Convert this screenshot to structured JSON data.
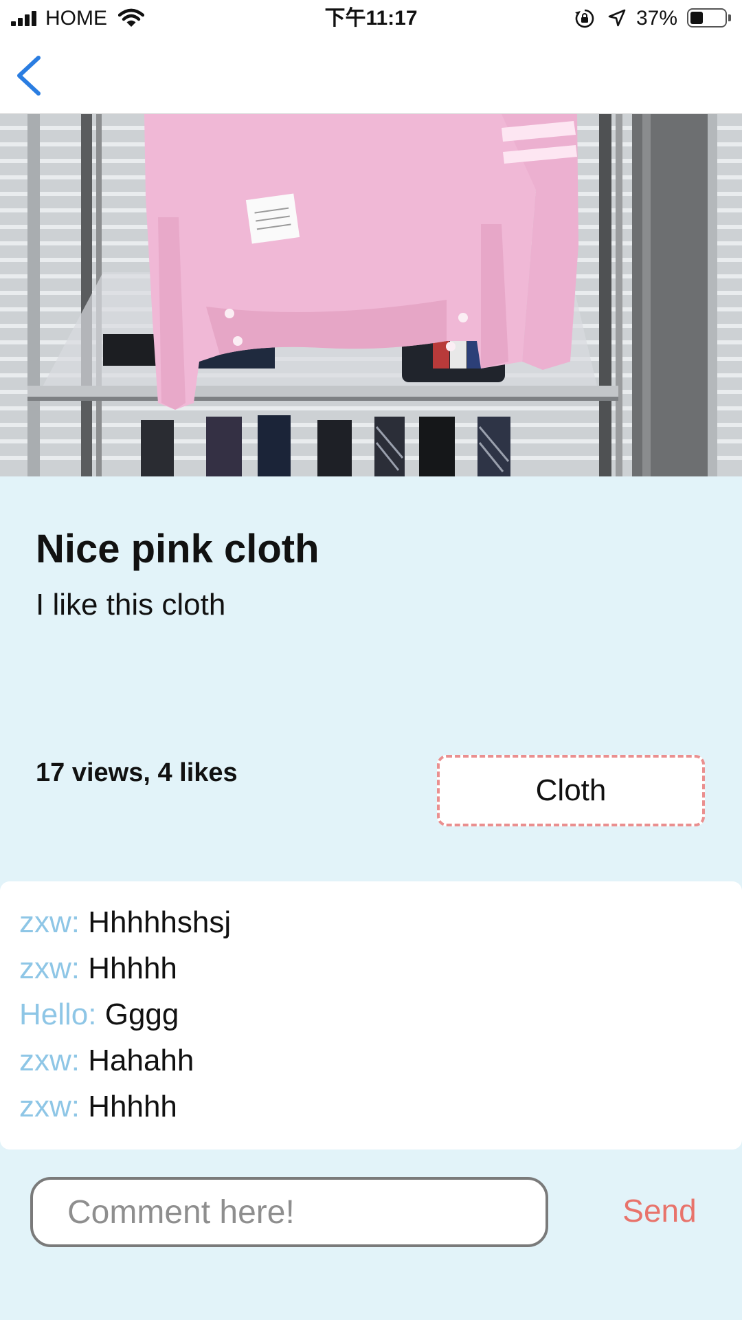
{
  "status_bar": {
    "carrier": "HOME",
    "time": "下午11:17",
    "battery_percent": "37%",
    "battery_level": 0.37
  },
  "nav": {
    "back_icon": "chevron-left-icon",
    "accent_color": "#2a7de1"
  },
  "post": {
    "image_subject": "pink sweatshirt on display shelf",
    "title": "Nice pink cloth",
    "description": "I like this cloth",
    "stats": "17 views, 4 likes",
    "category": "Cloth"
  },
  "comments": [
    {
      "author": "zxw:",
      "text": "Hhhhhshsj"
    },
    {
      "author": "zxw:",
      "text": "Hhhhh"
    },
    {
      "author": "Hello:",
      "text": "Gggg"
    },
    {
      "author": "zxw:",
      "text": "Hahahh"
    },
    {
      "author": "zxw:",
      "text": "Hhhhh"
    }
  ],
  "composer": {
    "placeholder": "Comment here!",
    "value": "",
    "send_label": "Send"
  },
  "colors": {
    "background": "#e2f3f9",
    "comment_author": "#8ec6e6",
    "send": "#e8736b",
    "tag_border": "#ea8f8f"
  }
}
